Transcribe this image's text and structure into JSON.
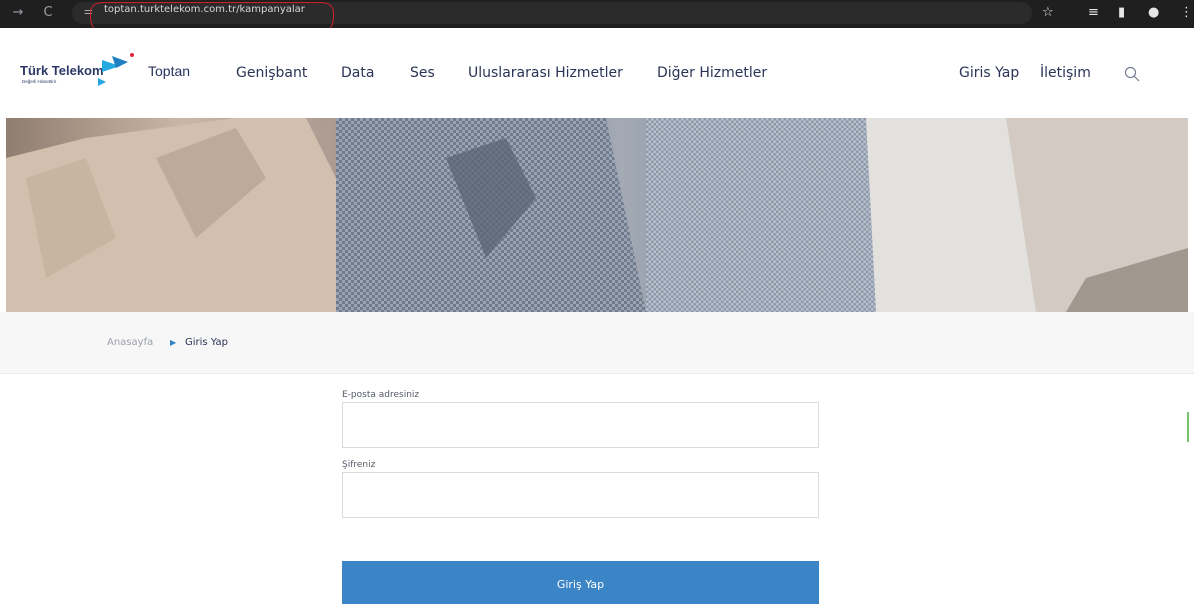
{
  "browser": {
    "url": "toptan.turktelekom.com.tr/kampanyalar"
  },
  "brand": {
    "name": "Türk Telekom",
    "tagline": "Değerli Hissettirir",
    "section": "Toptan"
  },
  "nav": {
    "items": [
      "Genişbant",
      "Data",
      "Ses",
      "Uluslararası Hizmetler",
      "Diğer Hizmetler"
    ],
    "login": "Giris Yap",
    "contact": "İletişim"
  },
  "breadcrumb": {
    "home": "Anasayfa",
    "current": "Giris Yap"
  },
  "form": {
    "email_label": "E-posta adresiniz",
    "email_value": "",
    "password_label": "Şifreniz",
    "password_value": "",
    "submit_label": "Giriş Yap"
  },
  "colors": {
    "brand_navy": "#2b3356",
    "accent_blue": "#3b84c6",
    "url_highlight": "#d0202a"
  },
  "icons": [
    "back-icon",
    "reload-icon",
    "site-info-icon",
    "bookmark-star-icon",
    "reading-list-icon",
    "side-panel-icon",
    "profile-icon",
    "chrome-menu-icon",
    "search-icon"
  ]
}
